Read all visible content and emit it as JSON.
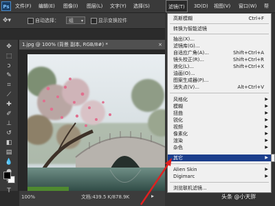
{
  "app": {
    "logo": "Ps"
  },
  "menubar": {
    "items": [
      "文件(F)",
      "编辑(E)",
      "图像(I)",
      "图层(L)",
      "文字(Y)",
      "选择(S)",
      "滤镜(T)",
      "3D(D)",
      "视图(V)",
      "窗口(W)",
      "帮"
    ],
    "active": "滤镜(T)"
  },
  "options_bar": {
    "auto_select_label": "自动选择：",
    "auto_select_value": "组",
    "show_transform_label": "显示变换控件"
  },
  "document": {
    "tab_title": "1.jpg @ 100% (背景 副本, RGB/8#) *",
    "zoom": "100%",
    "doc_info": "文档:439.5 K/878.9K"
  },
  "filter_menu": {
    "items": [
      {
        "label": "高斯模糊",
        "shortcut": "Ctrl+F"
      },
      {
        "sep": true
      },
      {
        "label": "转换为智能滤镜"
      },
      {
        "sep": true
      },
      {
        "label": "抽出(X)...",
        "shortcut": ""
      },
      {
        "label": "滤镜库(G)..."
      },
      {
        "label": "自适应广角(A)...",
        "shortcut": "Shift+Ctrl+A"
      },
      {
        "label": "镜头校正(R)...",
        "shortcut": "Shift+Ctrl+R"
      },
      {
        "label": "液化(L)...",
        "shortcut": "Shift+Ctrl+X"
      },
      {
        "label": "油画(O)..."
      },
      {
        "label": "图案生成器(P)..."
      },
      {
        "label": "消失点(V)...",
        "shortcut": "Alt+Ctrl+V"
      },
      {
        "sep": true
      },
      {
        "label": "风格化",
        "submenu": true
      },
      {
        "label": "模糊",
        "submenu": true
      },
      {
        "label": "扭曲",
        "submenu": true
      },
      {
        "label": "锐化",
        "submenu": true
      },
      {
        "label": "视频",
        "submenu": true
      },
      {
        "label": "像素化",
        "submenu": true
      },
      {
        "label": "渲染",
        "submenu": true
      },
      {
        "label": "杂色",
        "submenu": true
      },
      {
        "label": "其它",
        "submenu": true,
        "highlighted": true
      },
      {
        "sep": true
      },
      {
        "label": "Alien Skin",
        "submenu": true
      },
      {
        "label": "Digimarc",
        "submenu": true
      },
      {
        "sep": true
      },
      {
        "label": "浏览联机滤镜..."
      }
    ]
  },
  "watermark": "头条 @小天胖",
  "icons": {
    "tools": [
      "move-tool",
      "marquee-tool",
      "lasso-tool",
      "quick-select-tool",
      "crop-tool",
      "eyedropper-tool",
      "healing-tool",
      "brush-tool",
      "clone-stamp-tool",
      "history-brush-tool",
      "eraser-tool",
      "gradient-tool",
      "blur-tool",
      "dodge-tool",
      "pen-tool",
      "type-tool"
    ]
  },
  "colors": {
    "highlight": "#1b3e8c",
    "arrow": "#e02020"
  }
}
